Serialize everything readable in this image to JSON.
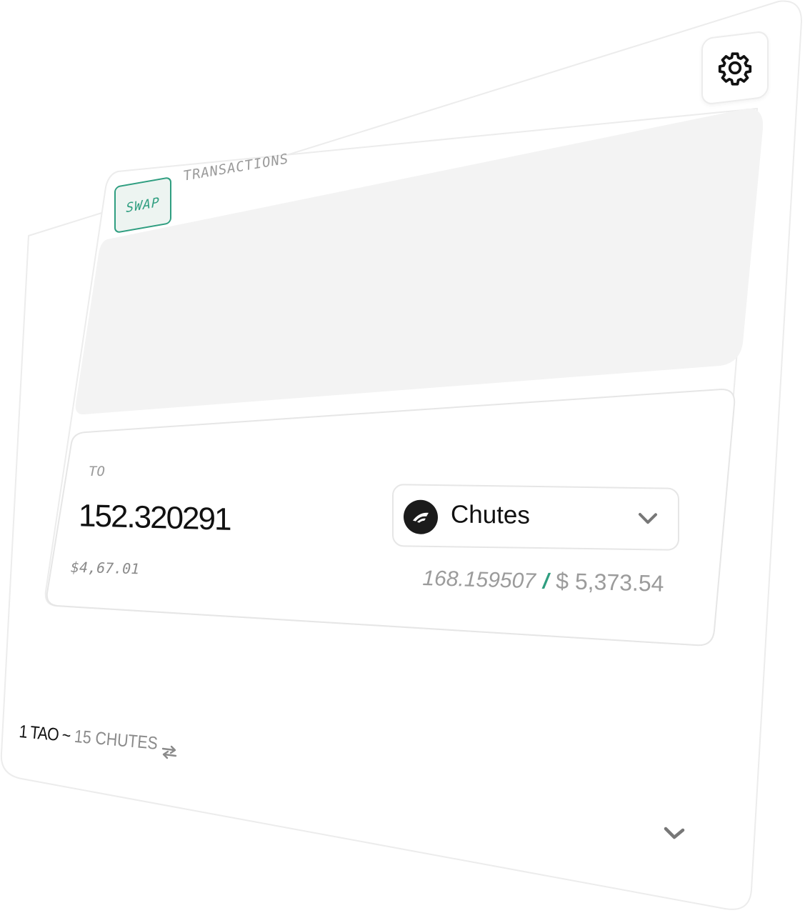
{
  "settings": {
    "icon": "gear-icon"
  },
  "tabs": [
    {
      "label": "SWAP",
      "active": true
    },
    {
      "label": "TRANSACTIONS",
      "active": false
    }
  ],
  "to_section": {
    "label": "TO",
    "amount": "152.320291",
    "usd_value": "$4,67.01",
    "token": {
      "name": "Chutes",
      "icon": "chutes-logo-icon"
    },
    "balance": "168.159507",
    "separator": "/",
    "balance_usd": "$ 5,373.54"
  },
  "rate": {
    "base": "1 TAO ~",
    "quote": "15 CHUTES",
    "icon": "swap-arrows-icon"
  },
  "footer": {
    "icon": "chevron-down-icon"
  },
  "colors": {
    "accent": "#2f9e80",
    "panel_grey": "#f3f3f3",
    "border": "#e8e8e8",
    "text_dark": "#111111",
    "text_muted": "#9a9a9a"
  }
}
